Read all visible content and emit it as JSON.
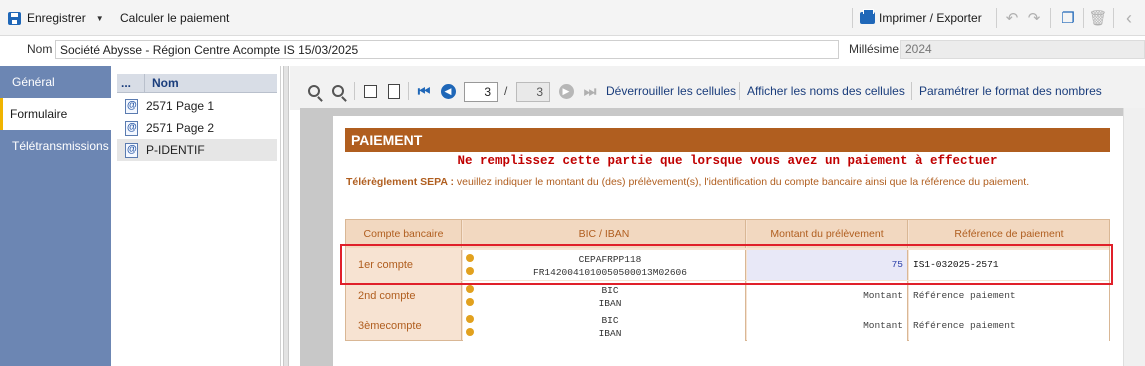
{
  "toolbar": {
    "save_label": "Enregistrer",
    "calc_label": "Calculer le paiement",
    "print_label": "Imprimer / Exporter"
  },
  "header": {
    "name_label": "Nom",
    "name_value": "Société Abysse - Région Centre Acompte IS 15/03/2025",
    "millesime_label": "Millésime",
    "millesime_value": "2024"
  },
  "sidebar": {
    "items": [
      {
        "label": "Général",
        "active": false
      },
      {
        "label": "Formulaire",
        "active": true
      },
      {
        "label": "Télétransmissions",
        "active": false
      }
    ]
  },
  "list": {
    "col_dots": "...",
    "col_name": "Nom",
    "items": [
      {
        "label": "2571 Page 1",
        "selected": false
      },
      {
        "label": "2571 Page 2",
        "selected": false
      },
      {
        "label": "P-IDENTIF",
        "selected": true
      }
    ]
  },
  "form_toolbar": {
    "current_page": "3",
    "total_pages": "3",
    "page_sep": "/",
    "unlock_label": "Déverrouiller les cellules",
    "show_names_label": "Afficher les noms des cellules",
    "format_label": "Paramétrer le format des nombres"
  },
  "form": {
    "banner": "PAIEMENT",
    "warning": "Ne remplissez cette partie que lorsque vous avez un paiement à effectuer",
    "sepa_bold": "Télérèglement SEPA :",
    "sepa_text": " veuillez indiquer le montant du (des) prélèvement(s), l'identification du compte bancaire ainsi que la référence du paiement.",
    "columns": [
      "Compte bancaire",
      "BIC / IBAN",
      "Montant du prélèvement",
      "Référence de paiement"
    ],
    "rows": [
      {
        "label": "1er compte",
        "bic": "CEPAFRPP118",
        "iban": "FR1420041010050500013M02606",
        "amount": "75",
        "reference": "IS1-032025-2571"
      },
      {
        "label": "2nd compte",
        "bic": "BIC",
        "iban": "IBAN",
        "amount": "Montant",
        "reference": "Référence paiement"
      },
      {
        "label": "3èmecompte",
        "bic": "BIC",
        "iban": "IBAN",
        "amount": "Montant",
        "reference": "Référence paiement"
      }
    ]
  },
  "colors": {
    "accent_brown": "#b05e1f",
    "nav_blue": "#6c86b3",
    "highlight_red": "#e0202a"
  }
}
